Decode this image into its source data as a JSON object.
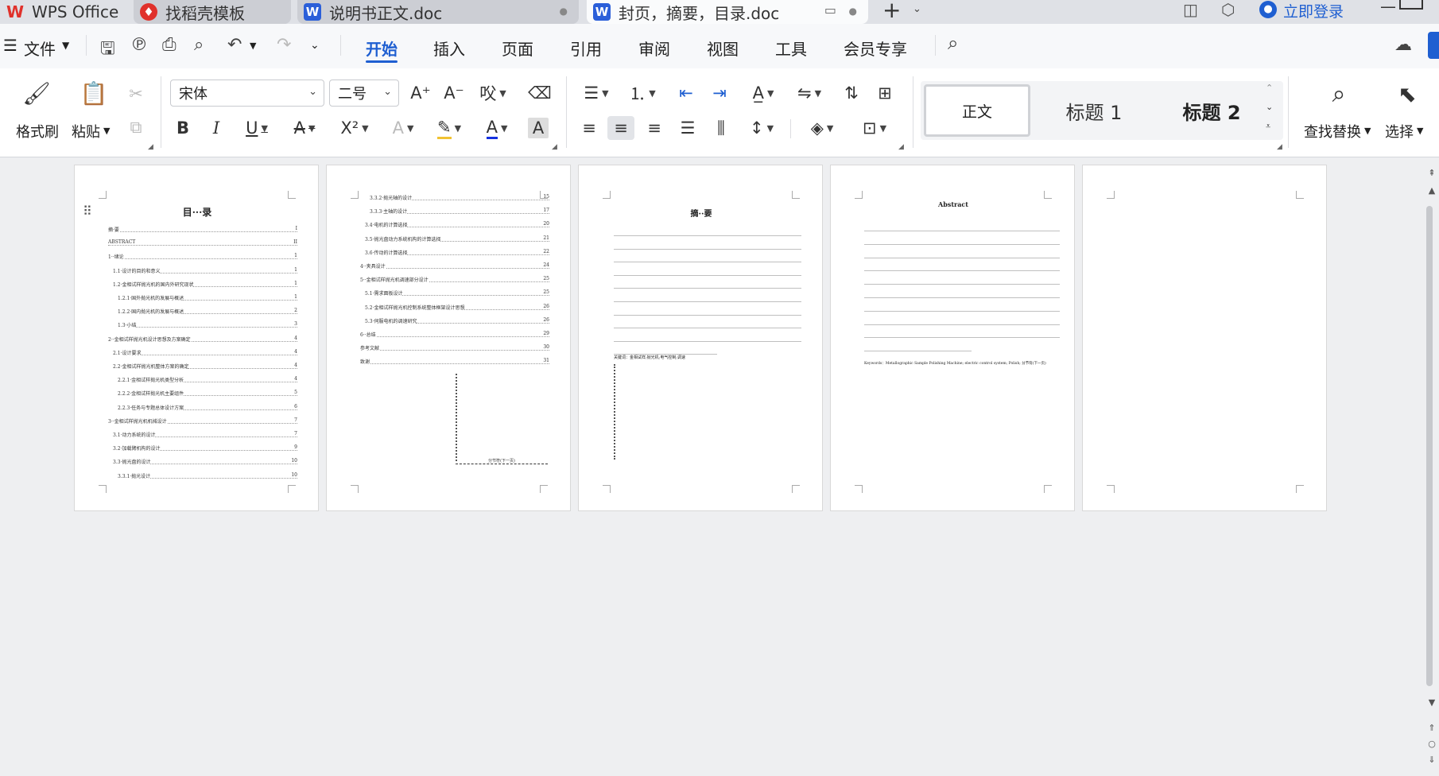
{
  "tabs": [
    {
      "label": "WPS Office",
      "icon": "wps-logo-icon"
    },
    {
      "label": "找稻壳模板",
      "icon": "docer-icon"
    },
    {
      "label": "说明书正文.doc",
      "icon": "word-doc-icon"
    },
    {
      "label": "封页，摘要，目录.doc",
      "icon": "word-doc-icon",
      "active": true
    }
  ],
  "tabbar": {
    "new_tab": "+",
    "login": "立即登录"
  },
  "menu": {
    "file": "文件",
    "tabs": [
      "开始",
      "插入",
      "页面",
      "引用",
      "审阅",
      "视图",
      "工具",
      "会员专享"
    ],
    "active": "开始"
  },
  "ribbon": {
    "format_painter": "格式刷",
    "paste": "粘贴",
    "font_name": "宋体",
    "font_size": "二号",
    "styles": [
      "正文",
      "标题 1",
      "标题 2"
    ],
    "find_replace": "查找替换",
    "select": "选择"
  },
  "pages": {
    "p1": {
      "title": "目···录",
      "toc": [
        {
          "t": "摘·要",
          "p": "I",
          "l": 0
        },
        {
          "t": "ABSTRACT",
          "p": "II",
          "l": 0
        },
        {
          "t": "1··绪论",
          "p": "1",
          "l": 0
        },
        {
          "t": "1.1·设计的目的和意义",
          "p": "1",
          "l": 1
        },
        {
          "t": "1.2·金相试样抛光机的国内外研究现状",
          "p": "1",
          "l": 1
        },
        {
          "t": "1.2.1·国外抛光机的发展与概述",
          "p": "1",
          "l": 2
        },
        {
          "t": "1.2.2·国内抛光机的发展与概述",
          "p": "2",
          "l": 2
        },
        {
          "t": "1.3·小结",
          "p": "3",
          "l": 2
        },
        {
          "t": "2··金相试样抛光机设计思想及方案确定",
          "p": "4",
          "l": 0
        },
        {
          "t": "2.1·设计要求",
          "p": "4",
          "l": 1
        },
        {
          "t": "2.2·金相试样抛光机整体方案的确定",
          "p": "4",
          "l": 1
        },
        {
          "t": "2.2.1·金相试样抛光机类型分析",
          "p": "4",
          "l": 2
        },
        {
          "t": "2.2.2·金相试样抛光机主要组件",
          "p": "5",
          "l": 2
        },
        {
          "t": "2.2.3·任务与专题总体设计方案",
          "p": "6",
          "l": 2
        },
        {
          "t": "3··金相试样抛光机机械设计",
          "p": "7",
          "l": 0
        },
        {
          "t": "3.1·动力系统的设计",
          "p": "7",
          "l": 1
        },
        {
          "t": "3.2·加载臂机构的设计",
          "p": "9",
          "l": 1
        },
        {
          "t": "3.3·抛光盘的设计",
          "p": "10",
          "l": 1
        },
        {
          "t": "3.3.1·抛光设计",
          "p": "10",
          "l": 2
        }
      ]
    },
    "p2": {
      "toc": [
        {
          "t": "3.3.2·抛光轴的设计",
          "p": "15",
          "l": 2
        },
        {
          "t": "3.3.3·主轴的设计",
          "p": "17",
          "l": 2
        },
        {
          "t": "3.4·电机的计算选择",
          "p": "20",
          "l": 1
        },
        {
          "t": "3.5·抛光盘动力系统机构的计算选择",
          "p": "21",
          "l": 1
        },
        {
          "t": "3.6·传动的计算选择",
          "p": "22",
          "l": 1
        },
        {
          "t": "4··夹具设计",
          "p": "24",
          "l": 0
        },
        {
          "t": "5··金相试样抛光机调速部分设计",
          "p": "25",
          "l": 0
        },
        {
          "t": "5.1·需求面板设计",
          "p": "25",
          "l": 1
        },
        {
          "t": "5.2·金相试样抛光机控制系统整体框架设计思想",
          "p": "26",
          "l": 1
        },
        {
          "t": "5.3·伺服电机的调速研究",
          "p": "26",
          "l": 1
        },
        {
          "t": "6··总结",
          "p": "29",
          "l": 0
        },
        {
          "t": "参考文献",
          "p": "30",
          "l": 0
        },
        {
          "t": "致谢",
          "p": "31",
          "l": 0
        }
      ],
      "section_break": "分节符(下一页)"
    },
    "p3": {
      "title": "摘··要",
      "keywords": "关键词：金相试样;抛光机;电气控制;调速"
    },
    "p4": {
      "title": "Abstract",
      "keywords": "Keywords：Metallographic Sample Polishing Machine; electric control system; Polish; 分节符(下一页)"
    }
  },
  "colors": {
    "accent": "#1f5fd1",
    "wps_red": "#e0312b",
    "word_blue": "#2b5fd9"
  }
}
